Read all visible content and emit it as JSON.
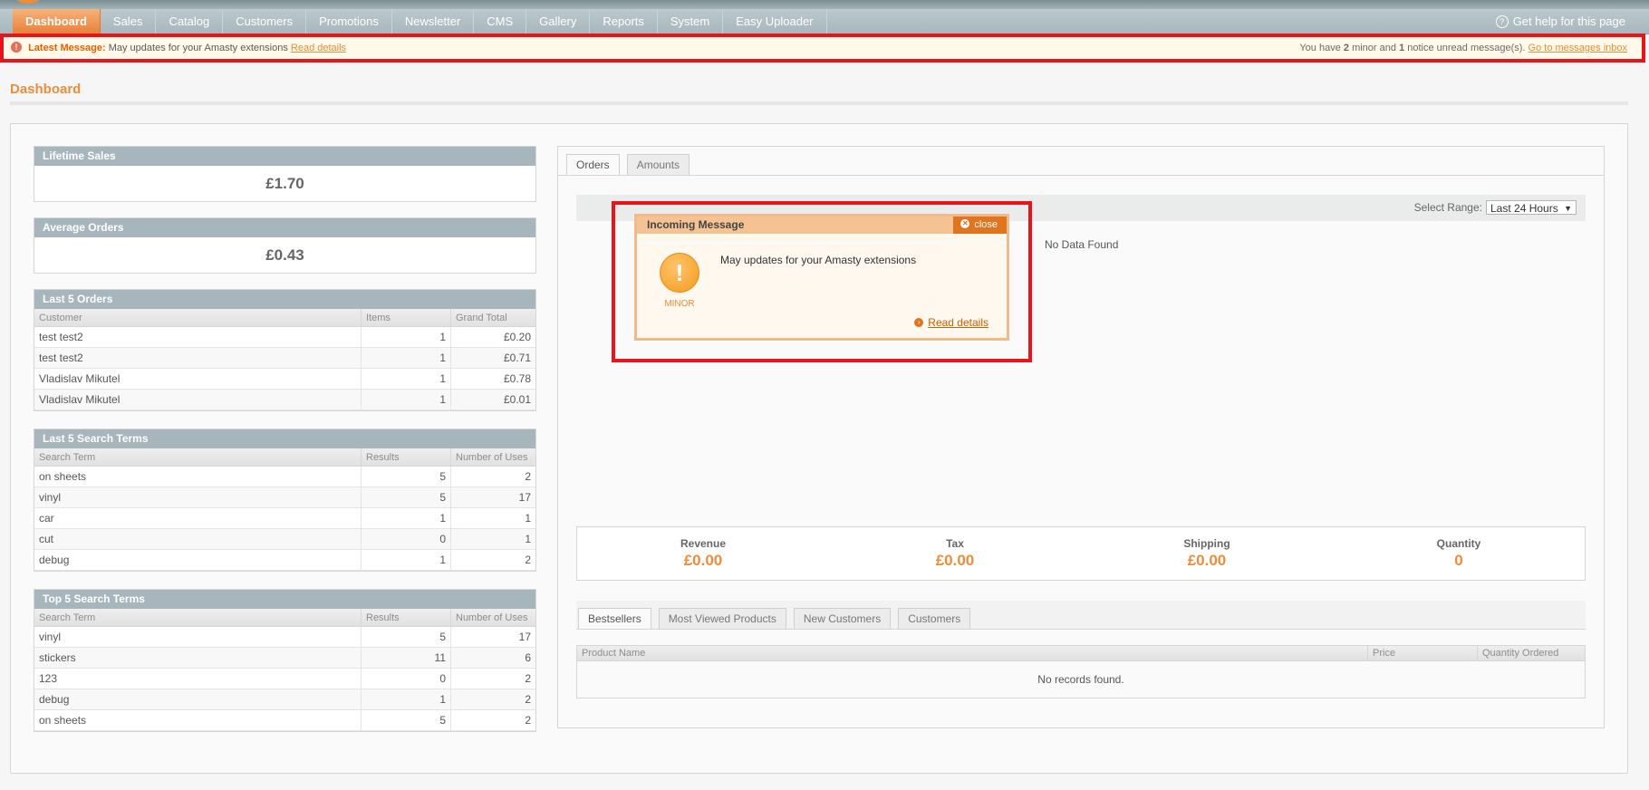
{
  "nav": {
    "items": [
      "Dashboard",
      "Sales",
      "Catalog",
      "Customers",
      "Promotions",
      "Newsletter",
      "CMS",
      "Gallery",
      "Reports",
      "System",
      "Easy Uploader"
    ],
    "help": "Get help for this page"
  },
  "notice": {
    "label": "Latest Message:",
    "message": "May updates for your Amasty extensions",
    "link": "Read details",
    "right_pre": "You have",
    "minor_count": "2",
    "right_mid": "minor and",
    "notice_count": "1",
    "right_post": "notice unread message(s).",
    "inbox_link": "Go to messages inbox"
  },
  "page_title": "Dashboard",
  "lifetime": {
    "title": "Lifetime Sales",
    "value": "£1.70"
  },
  "average": {
    "title": "Average Orders",
    "value": "£0.43"
  },
  "orders": {
    "title": "Last 5 Orders",
    "headers": [
      "Customer",
      "Items",
      "Grand Total"
    ],
    "rows": [
      [
        "test test2",
        "1",
        "£0.20"
      ],
      [
        "test test2",
        "1",
        "£0.71"
      ],
      [
        "Vladislav Mikutel",
        "1",
        "£0.78"
      ],
      [
        "Vladislav Mikutel",
        "1",
        "£0.01"
      ]
    ]
  },
  "last_terms": {
    "title": "Last 5 Search Terms",
    "headers": [
      "Search Term",
      "Results",
      "Number of Uses"
    ],
    "rows": [
      [
        "on sheets",
        "5",
        "2"
      ],
      [
        "vinyl",
        "5",
        "17"
      ],
      [
        "car",
        "1",
        "1"
      ],
      [
        "cut",
        "0",
        "1"
      ],
      [
        "debug",
        "1",
        "2"
      ]
    ]
  },
  "top_terms": {
    "title": "Top 5 Search Terms",
    "headers": [
      "Search Term",
      "Results",
      "Number of Uses"
    ],
    "rows": [
      [
        "vinyl",
        "5",
        "17"
      ],
      [
        "stickers",
        "11",
        "6"
      ],
      [
        "123",
        "0",
        "2"
      ],
      [
        "debug",
        "1",
        "2"
      ],
      [
        "on sheets",
        "5",
        "2"
      ]
    ]
  },
  "chart_tabs": [
    "Orders",
    "Amounts"
  ],
  "range": {
    "label": "Select Range:",
    "value": "Last 24 Hours"
  },
  "no_data": "No Data Found",
  "totals": [
    {
      "label": "Revenue",
      "value": "£0.00"
    },
    {
      "label": "Tax",
      "value": "£0.00"
    },
    {
      "label": "Shipping",
      "value": "£0.00"
    },
    {
      "label": "Quantity",
      "value": "0"
    }
  ],
  "bottom_tabs": [
    "Bestsellers",
    "Most Viewed Products",
    "New Customers",
    "Customers"
  ],
  "products": {
    "headers": [
      "Product Name",
      "Price",
      "Quantity Ordered"
    ],
    "empty": "No records found."
  },
  "popup": {
    "title": "Incoming Message",
    "close": "close",
    "severity": "MINOR",
    "message": "May updates for your Amasty extensions",
    "link": "Read details"
  },
  "icons": {
    "help": "help-circle-icon",
    "notice": "warning-icon",
    "close": "close-circle-icon",
    "severity": "exclamation-icon",
    "link": "arrow-circle-icon"
  },
  "colors": {
    "accent": "#eb8d3b",
    "highlight": "#e8141b"
  }
}
